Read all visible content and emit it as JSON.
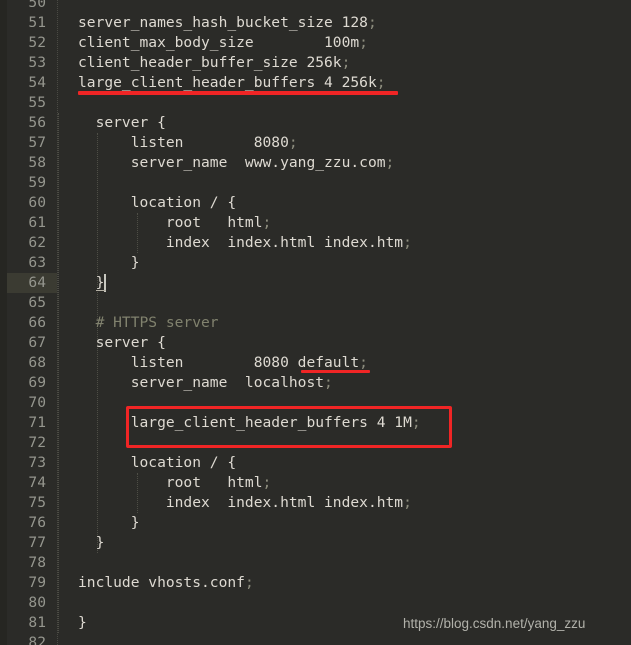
{
  "editor": {
    "language": "nginx",
    "background_color": "#2b2b28",
    "gutter_color": "#95968e",
    "text_color": "#dedad2",
    "comment_color": "#81826e",
    "punctuation_color": "#8d8d7e",
    "current_line": 64,
    "current_line_highlight_color": "#3b3b32"
  },
  "gutter": {
    "numbers": [
      "50",
      "51",
      "52",
      "53",
      "54",
      "55",
      "56",
      "57",
      "58",
      "59",
      "60",
      "61",
      "62",
      "63",
      "64",
      "65",
      "66",
      "67",
      "68",
      "69",
      "70",
      "71",
      "72",
      "73",
      "74",
      "75",
      "76",
      "77",
      "78",
      "79",
      "80",
      "81",
      "82"
    ]
  },
  "code": {
    "lines": [
      {
        "num": "50",
        "text": ""
      },
      {
        "num": "51",
        "text": "server_names_hash_bucket_size 128;"
      },
      {
        "num": "52",
        "text": "client_max_body_size        100m;"
      },
      {
        "num": "53",
        "text": "client_header_buffer_size 256k;"
      },
      {
        "num": "54",
        "text": "large_client_header_buffers 4 256k;"
      },
      {
        "num": "55",
        "text": ""
      },
      {
        "num": "56",
        "text": "  server {"
      },
      {
        "num": "57",
        "text": "      listen        8080;"
      },
      {
        "num": "58",
        "text": "      server_name  www.yang_zzu.com;"
      },
      {
        "num": "59",
        "text": ""
      },
      {
        "num": "60",
        "text": "      location / {"
      },
      {
        "num": "61",
        "text": "          root   html;"
      },
      {
        "num": "62",
        "text": "          index  index.html index.htm;"
      },
      {
        "num": "63",
        "text": "      }"
      },
      {
        "num": "64",
        "text": "  }"
      },
      {
        "num": "65",
        "text": ""
      },
      {
        "num": "66",
        "text": "  # HTTPS server"
      },
      {
        "num": "67",
        "text": "  server {"
      },
      {
        "num": "68",
        "text": "      listen        8080 default;"
      },
      {
        "num": "69",
        "text": "      server_name  localhost;"
      },
      {
        "num": "70",
        "text": ""
      },
      {
        "num": "71",
        "text": "      large_client_header_buffers 4 1M;"
      },
      {
        "num": "72",
        "text": ""
      },
      {
        "num": "73",
        "text": "      location / {"
      },
      {
        "num": "74",
        "text": "          root   html;"
      },
      {
        "num": "75",
        "text": "          index  index.html index.htm;"
      },
      {
        "num": "76",
        "text": "      }"
      },
      {
        "num": "77",
        "text": "  }"
      },
      {
        "num": "78",
        "text": ""
      },
      {
        "num": "79",
        "text": "include vhosts.conf;"
      },
      {
        "num": "80",
        "text": ""
      },
      {
        "num": "81",
        "text": "}"
      },
      {
        "num": "82",
        "text": ""
      }
    ],
    "tokens": {
      "line51": {
        "directive": "server_names_hash_bucket_size",
        "value": "128",
        "semi": ";"
      },
      "line52": {
        "directive": "client_max_body_size",
        "value": "100m",
        "semi": ";"
      },
      "line53": {
        "directive": "client_header_buffer_size",
        "value": "256k",
        "semi": ";"
      },
      "line54": {
        "directive": "large_client_header_buffers",
        "value": "4 256k",
        "semi": ";"
      },
      "line56": {
        "directive": "server",
        "brace": "{"
      },
      "line57": {
        "directive": "listen",
        "value": "8080",
        "semi": ";"
      },
      "line58": {
        "directive": "server_name",
        "value": "www.yang_zzu.com",
        "semi": ";"
      },
      "line60": {
        "directive": "location",
        "path": "/",
        "brace": "{"
      },
      "line61": {
        "directive": "root",
        "value": "html",
        "semi": ";"
      },
      "line62": {
        "directive": "index",
        "value": "index.html index.htm",
        "semi": ";"
      },
      "line63": {
        "brace": "}"
      },
      "line64": {
        "brace": "}"
      },
      "line66": {
        "comment": "# HTTPS server"
      },
      "line67": {
        "directive": "server",
        "brace": "{"
      },
      "line68": {
        "directive": "listen",
        "value": "8080 default",
        "semi": ";"
      },
      "line69": {
        "directive": "server_name",
        "value": "localhost",
        "semi": ";"
      },
      "line71": {
        "directive": "large_client_header_buffers",
        "value": "4 1M",
        "semi": ";"
      },
      "line73": {
        "directive": "location",
        "path": "/",
        "brace": "{"
      },
      "line74": {
        "directive": "root",
        "value": "html",
        "semi": ";"
      },
      "line75": {
        "directive": "index",
        "value": "index.html index.htm",
        "semi": ";"
      },
      "line76": {
        "brace": "}"
      },
      "line77": {
        "brace": "}"
      },
      "line79": {
        "directive": "include",
        "value": "vhosts.conf",
        "semi": ";"
      },
      "line81": {
        "brace": "}"
      }
    }
  },
  "annotations": {
    "color": "#f02525",
    "underline_line54": {
      "target_line": "54",
      "target_text": "large_client_header_buffers 4 256k;"
    },
    "underline_default": {
      "target_line": "68",
      "target_text": "default"
    },
    "box_line71": {
      "target_line": "71",
      "target_text": "large_client_header_buffers 4 1M;"
    }
  },
  "watermark": {
    "text": "https://blog.csdn.net/yang_zzu"
  }
}
